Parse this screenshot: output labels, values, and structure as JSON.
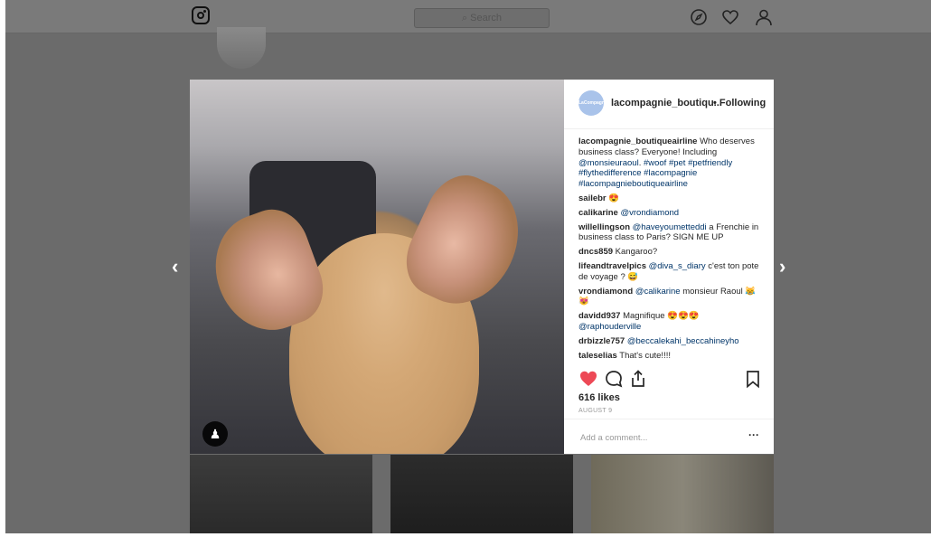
{
  "header": {
    "search_placeholder": "Search"
  },
  "post": {
    "username": "lacompagnie_boutiqu...",
    "following": "• Following",
    "avatar_text": "LaCompagnie",
    "comments": [
      {
        "user": "lacompagnie_boutiqueairline",
        "parts": [
          {
            "t": "Who deserves business class? Everyone! Including "
          },
          {
            "t": "@monsieuraoul",
            "m": true
          },
          {
            "t": ". "
          },
          {
            "t": "#woof #pet #petfriendly #flythedifference #lacompagnie #lacompagnieboutiqueairline",
            "m": true
          }
        ]
      },
      {
        "user": "sailebr",
        "parts": [
          {
            "t": "😍"
          }
        ]
      },
      {
        "user": "calikarine",
        "parts": [
          {
            "t": "@vrondiamond",
            "m": true
          }
        ]
      },
      {
        "user": "willellingson",
        "parts": [
          {
            "t": "@haveyoumetteddi",
            "m": true
          },
          {
            "t": " a Frenchie in business class to Paris? SIGN ME UP"
          }
        ]
      },
      {
        "user": "dncs859",
        "parts": [
          {
            "t": "Kangaroo?"
          }
        ]
      },
      {
        "user": "lifeandtravelpics",
        "parts": [
          {
            "t": "@diva_s_diary",
            "m": true
          },
          {
            "t": " c'est ton pote de voyage ? 😅"
          }
        ]
      },
      {
        "user": "vrondiamond",
        "parts": [
          {
            "t": "@calikarine",
            "m": true
          },
          {
            "t": " monsieur Raoul 😹😻"
          }
        ]
      },
      {
        "user": "davidd937",
        "parts": [
          {
            "t": "Magnifique 😍😍😍 "
          },
          {
            "t": "@raphouderville",
            "m": true
          }
        ]
      },
      {
        "user": "drbizzle757",
        "parts": [
          {
            "t": "@beccalekahi_beccahineyho",
            "m": true
          }
        ]
      },
      {
        "user": "taleselias",
        "parts": [
          {
            "t": "That's cute!!!!"
          }
        ]
      }
    ],
    "likes": "616 likes",
    "date": "AUGUST 9",
    "comment_placeholder": "Add a comment...",
    "more": "···"
  },
  "nav": {
    "prev": "‹",
    "next": "›"
  },
  "colors": {
    "heart": "#ed4956",
    "overlay": "#6b6b6b"
  }
}
